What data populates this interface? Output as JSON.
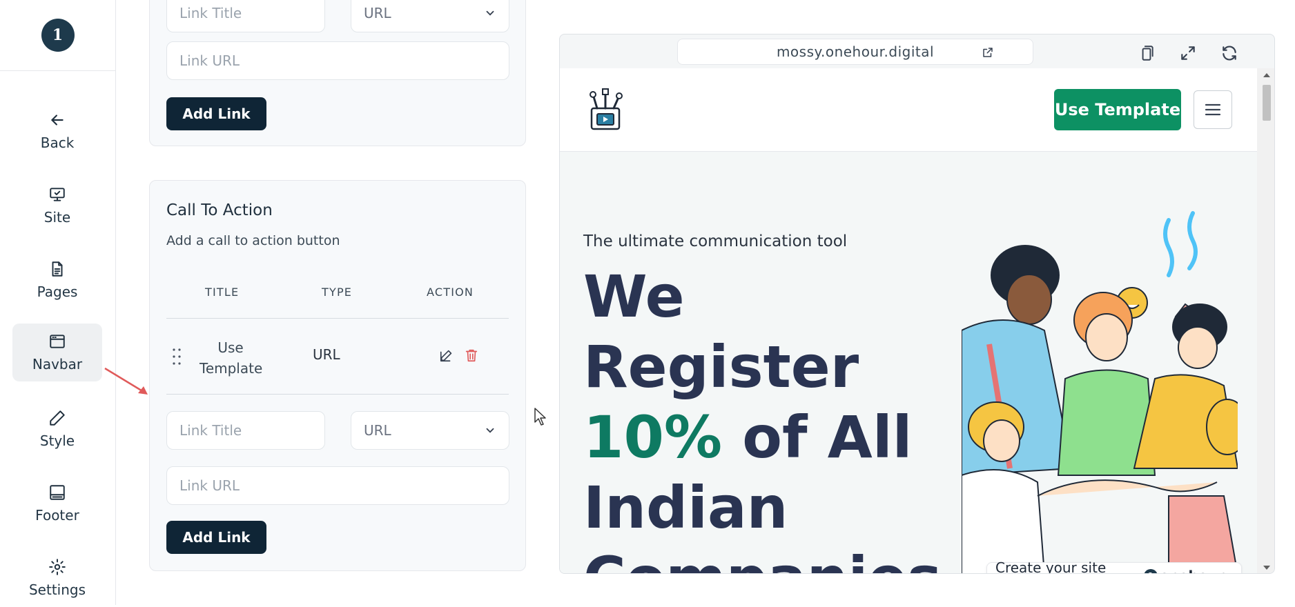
{
  "sidebar": {
    "logo_text": "1",
    "items": [
      {
        "label": "Back",
        "icon": "arrow-left-icon"
      },
      {
        "label": "Site",
        "icon": "monitor-icon"
      },
      {
        "label": "Pages",
        "icon": "document-icon"
      },
      {
        "label": "Navbar",
        "icon": "window-icon",
        "active": true
      },
      {
        "label": "Style",
        "icon": "pencil-icon"
      },
      {
        "label": "Footer",
        "icon": "footer-icon"
      },
      {
        "label": "Settings",
        "icon": "gear-icon"
      }
    ]
  },
  "top_form": {
    "link_title_placeholder": "Link Title",
    "type_value": "URL",
    "link_url_placeholder": "Link URL",
    "add_button": "Add Link"
  },
  "cta_section": {
    "title": "Call To Action",
    "subtitle": "Add a call to action button",
    "columns": [
      "TITLE",
      "TYPE",
      "ACTION"
    ],
    "rows": [
      {
        "title": "Use Template",
        "type": "URL"
      }
    ],
    "link_title_placeholder": "Link Title",
    "type_value": "URL",
    "link_url_placeholder": "Link URL",
    "add_button": "Add Link"
  },
  "preview": {
    "url": "mossy.onehour.digital",
    "site": {
      "cta_button": "Use Template",
      "tagline": "The ultimate communication tool",
      "headline_line1": "We Register",
      "headline_highlight": "10%",
      "headline_line2_rest": " of All",
      "headline_line3": "Indian",
      "headline_line4": "Companies"
    },
    "badge": {
      "text": "Create your site within",
      "brand": "onehour"
    }
  },
  "colors": {
    "accent_green": "#0d9163",
    "dark_button": "#0f2536",
    "headline": "#2a3452",
    "delete_red": "#e05a5a"
  }
}
